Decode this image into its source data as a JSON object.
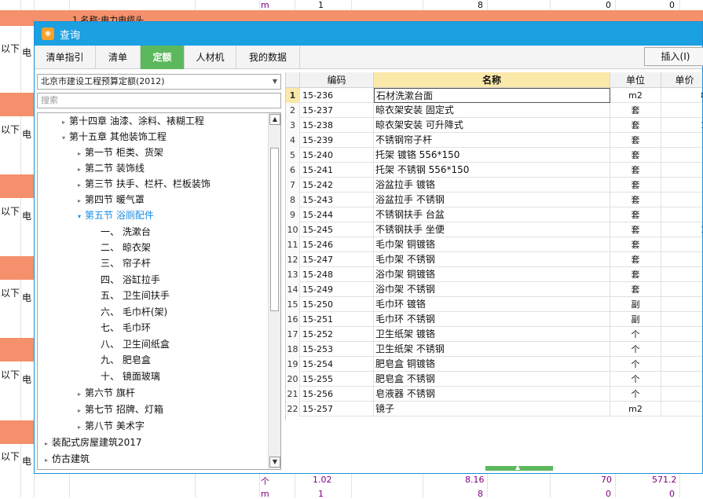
{
  "background": {
    "top_row": {
      "label": "1 名称:电力电缆头",
      "unit": "m",
      "v1": "1",
      "v2": "8",
      "v3": "0",
      "v4": "0"
    },
    "side_labels": [
      "以下",
      "以下",
      "以下",
      "以下",
      "以下",
      "以下"
    ],
    "side_labels2": [
      "电",
      "电",
      "电",
      "电",
      "电",
      "电"
    ],
    "bottom_row": {
      "unit": "个",
      "v1": "1.02",
      "v2": "8.16",
      "v3": "70",
      "v4": "571.2"
    },
    "last_row": {
      "unit": "m",
      "v1": "1",
      "v2": "8",
      "v3": "0",
      "v4": "0"
    }
  },
  "dialog": {
    "title": "查询",
    "tabs": [
      {
        "label": "清单指引"
      },
      {
        "label": "清单"
      },
      {
        "label": "定额"
      },
      {
        "label": "人材机"
      },
      {
        "label": "我的数据"
      }
    ],
    "insert_label": "插入(I)",
    "quota_select_value": "北京市建设工程预算定额(2012)",
    "search_placeholder": "搜索",
    "tree": [
      {
        "label": "第十四章  油漆、涂料、裱糊工程",
        "level": 1,
        "toggle": "▸"
      },
      {
        "label": "第十五章  其他装饰工程",
        "level": 1,
        "toggle": "▾"
      },
      {
        "label": "第一节  柜类、货架",
        "level": 2,
        "toggle": "▸"
      },
      {
        "label": "第二节  装饰线",
        "level": 2,
        "toggle": "▸"
      },
      {
        "label": "第三节  扶手、栏杆、栏板装饰",
        "level": 2,
        "toggle": "▸"
      },
      {
        "label": "第四节  暖气罩",
        "level": 2,
        "toggle": "▸"
      },
      {
        "label": "第五节  浴厕配件",
        "level": 2,
        "toggle": "▾",
        "selected": true
      },
      {
        "label": "一、  洗漱台",
        "level": 3,
        "toggle": ""
      },
      {
        "label": "二、  晾衣架",
        "level": 3,
        "toggle": ""
      },
      {
        "label": "三、  帘子杆",
        "level": 3,
        "toggle": ""
      },
      {
        "label": "四、  浴缸拉手",
        "level": 3,
        "toggle": ""
      },
      {
        "label": "五、  卫生间扶手",
        "level": 3,
        "toggle": ""
      },
      {
        "label": "六、  毛巾杆(架)",
        "level": 3,
        "toggle": ""
      },
      {
        "label": "七、  毛巾环",
        "level": 3,
        "toggle": ""
      },
      {
        "label": "八、  卫生间纸盒",
        "level": 3,
        "toggle": ""
      },
      {
        "label": "九、  肥皂盒",
        "level": 3,
        "toggle": ""
      },
      {
        "label": "十、  镜面玻璃",
        "level": 3,
        "toggle": ""
      },
      {
        "label": "第六节  旗杆",
        "level": 2,
        "toggle": "▸"
      },
      {
        "label": "第七节  招牌、灯箱",
        "level": 2,
        "toggle": "▸"
      },
      {
        "label": "第八节  美术字",
        "level": 2,
        "toggle": "▸"
      },
      {
        "label": "装配式房屋建筑2017",
        "level": 0,
        "toggle": "▸"
      },
      {
        "label": "仿古建筑",
        "level": 0,
        "toggle": "▸"
      }
    ],
    "grid": {
      "headers": {
        "code": "编码",
        "name": "名称",
        "unit": "单位",
        "price": "单价"
      },
      "rows": [
        {
          "n": "1",
          "code": "15-236",
          "name": "石材洗漱台面",
          "unit": "m2",
          "price": "8"
        },
        {
          "n": "2",
          "code": "15-237",
          "name": "晾衣架安装 固定式",
          "unit": "套",
          "price": ""
        },
        {
          "n": "3",
          "code": "15-238",
          "name": "晾衣架安装 可升降式",
          "unit": "套",
          "price": "1"
        },
        {
          "n": "4",
          "code": "15-239",
          "name": "不锈钢帘子杆",
          "unit": "套",
          "price": ""
        },
        {
          "n": "5",
          "code": "15-240",
          "name": "托架 镀铬 556*150",
          "unit": "套",
          "price": ""
        },
        {
          "n": "6",
          "code": "15-241",
          "name": "托架 不锈钢 556*150",
          "unit": "套",
          "price": ""
        },
        {
          "n": "7",
          "code": "15-242",
          "name": "浴盆拉手 镀铬",
          "unit": "套",
          "price": ""
        },
        {
          "n": "8",
          "code": "15-243",
          "name": "浴盆拉手 不锈钢",
          "unit": "套",
          "price": ""
        },
        {
          "n": "9",
          "code": "15-244",
          "name": "不锈钢扶手 台盆",
          "unit": "套",
          "price": ""
        },
        {
          "n": "10",
          "code": "15-245",
          "name": "不锈钢扶手 坐便",
          "unit": "套",
          "price": "1"
        },
        {
          "n": "11",
          "code": "15-246",
          "name": "毛巾架 铜镀铬",
          "unit": "套",
          "price": ""
        },
        {
          "n": "12",
          "code": "15-247",
          "name": "毛巾架 不锈钢",
          "unit": "套",
          "price": ""
        },
        {
          "n": "13",
          "code": "15-248",
          "name": "浴巾架 铜镀铬",
          "unit": "套",
          "price": ""
        },
        {
          "n": "14",
          "code": "15-249",
          "name": "浴巾架 不锈钢",
          "unit": "套",
          "price": ""
        },
        {
          "n": "15",
          "code": "15-250",
          "name": "毛巾环 镀铬",
          "unit": "副",
          "price": ""
        },
        {
          "n": "16",
          "code": "15-251",
          "name": "毛巾环 不锈钢",
          "unit": "副",
          "price": ""
        },
        {
          "n": "17",
          "code": "15-252",
          "name": "卫生纸架 镀铬",
          "unit": "个",
          "price": ""
        },
        {
          "n": "18",
          "code": "15-253",
          "name": "卫生纸架 不锈钢",
          "unit": "个",
          "price": ""
        },
        {
          "n": "19",
          "code": "15-254",
          "name": "肥皂盒 铜镀铬",
          "unit": "个",
          "price": ""
        },
        {
          "n": "20",
          "code": "15-255",
          "name": "肥皂盒 不锈钢",
          "unit": "个",
          "price": ""
        },
        {
          "n": "21",
          "code": "15-256",
          "name": "皂液器 不锈钢",
          "unit": "个",
          "price": ""
        },
        {
          "n": "22",
          "code": "15-257",
          "name": "镜子",
          "unit": "m2",
          "price": ""
        }
      ]
    }
  },
  "colors": {
    "titlebar": "#1ba0e2",
    "active_tab": "#5cb85c",
    "selected_node": "#1a8ce0",
    "bg_orange": "#f4906b",
    "column_highlight": "#fbe9a9"
  }
}
